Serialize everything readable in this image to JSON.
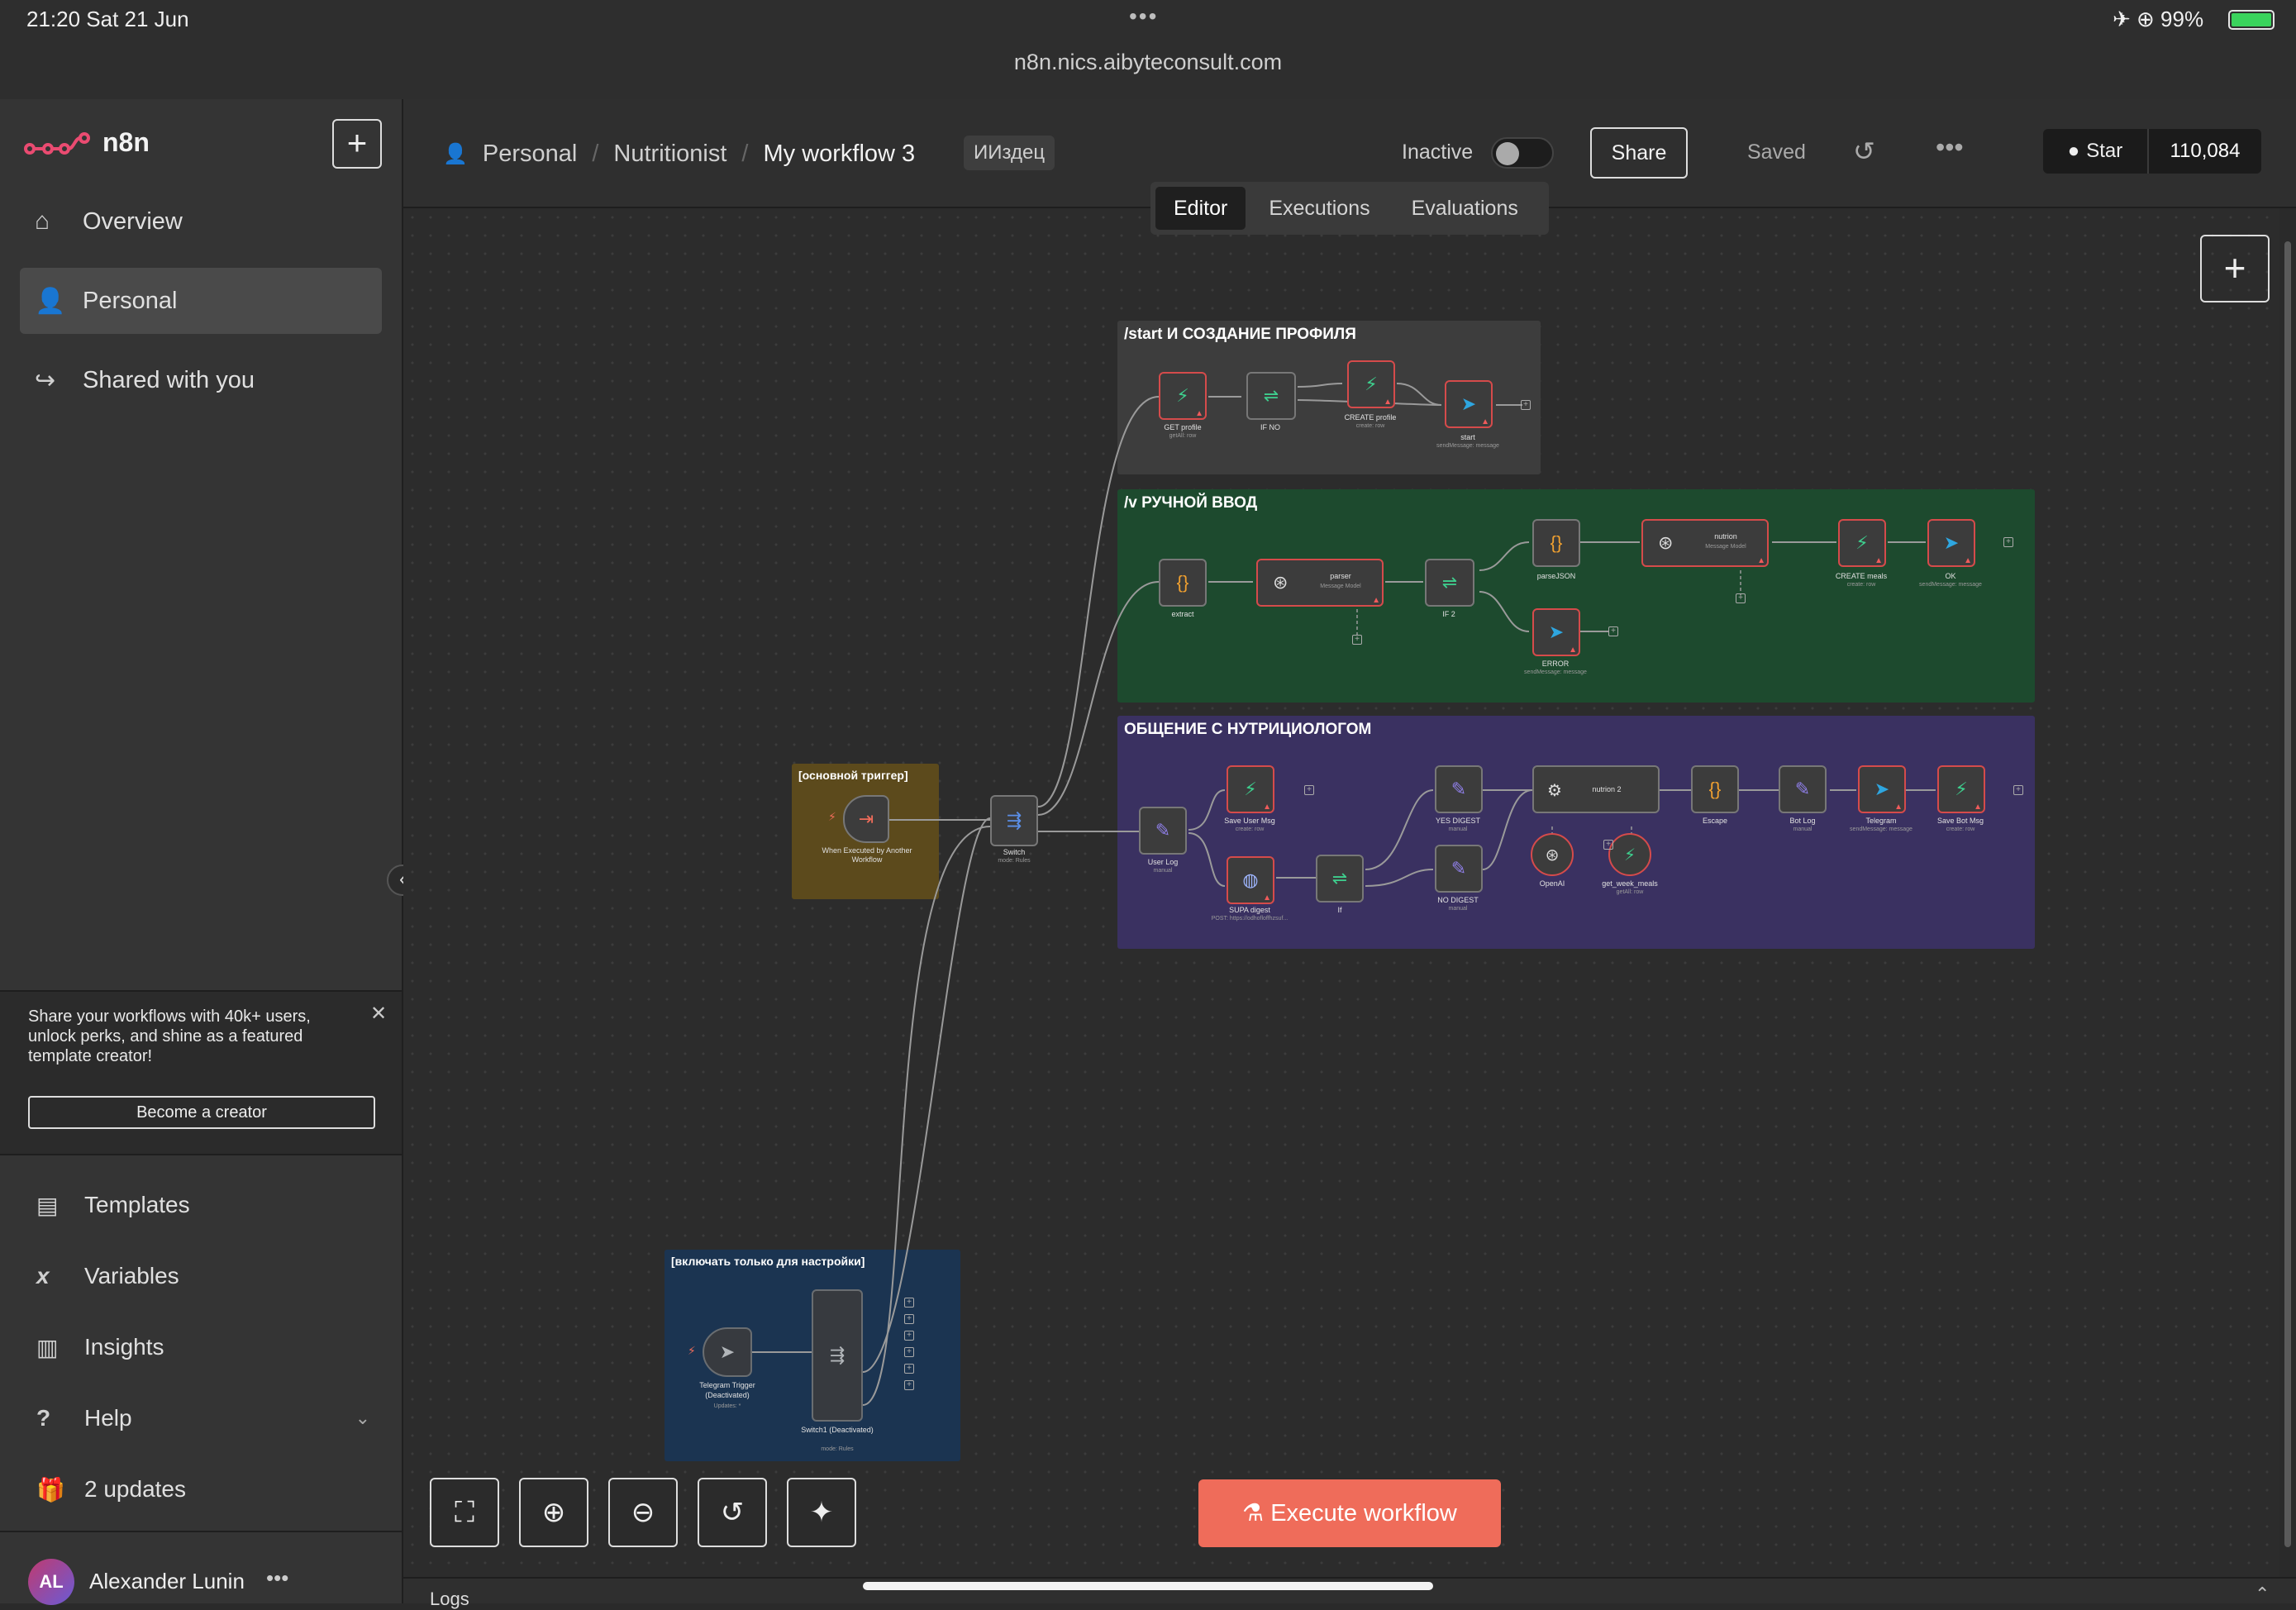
{
  "status_bar": {
    "time": "21:20  Sat 21 Jun",
    "dots": "•••",
    "url": "n8n.nics.aibyteconsult.com",
    "right": "✈ ⊕ 99%"
  },
  "sidebar": {
    "logo_text": "n8n",
    "new_icon": "plus-icon",
    "items": [
      {
        "label": "Overview",
        "icon": "home-icon"
      },
      {
        "label": "Personal",
        "icon": "user-icon"
      },
      {
        "label": "Shared with you",
        "icon": "share-icon"
      }
    ],
    "promo": {
      "text": "Share your workflows with 40k+ users, unlock perks, and shine as a featured template creator!",
      "button": "Become a creator"
    },
    "bottom_items": [
      {
        "label": "Templates",
        "icon": "templates-icon"
      },
      {
        "label": "Variables",
        "icon": "variables-icon"
      },
      {
        "label": "Insights",
        "icon": "insights-icon"
      },
      {
        "label": "Help",
        "icon": "help-icon"
      },
      {
        "label": "2 updates",
        "icon": "gift-icon"
      }
    ],
    "user": {
      "initials": "AL",
      "name": "Alexander Lunin",
      "more": "•••"
    }
  },
  "header": {
    "breadcrumb": [
      "Personal",
      "Nutritionist",
      "My workflow 3"
    ],
    "tag": "ИИздец",
    "status_label": "Inactive",
    "share": "Share",
    "saved": "Saved",
    "more": "•••",
    "github": {
      "label": "Star",
      "count": "110,084"
    },
    "tabs": [
      "Editor",
      "Executions",
      "Evaluations"
    ]
  },
  "canvas": {
    "stickies": [
      {
        "id": "s1",
        "title": "/start И СОЗДАНИЕ ПРОФИЛЯ",
        "color": "#3d3d3d"
      },
      {
        "id": "s2",
        "title": "/v РУЧНОЙ ВВОД",
        "color": "#1d4a2e"
      },
      {
        "id": "s3",
        "title": "ОБЩЕНИЕ С НУТРИЦИОЛОГОМ",
        "color": "#3a3161"
      },
      {
        "id": "s4",
        "title": "[основной триггер]",
        "color": "#5c4a1c"
      },
      {
        "id": "s5",
        "title": "[включать только для настройки]",
        "color": "#1b3451"
      }
    ],
    "nodes": {
      "get_profile": {
        "label": "GET profile",
        "sub": "getAll: row"
      },
      "if_no": {
        "label": "IF NO",
        "sub": ""
      },
      "create_profile": {
        "label": "CREATE profile",
        "sub": "create: row"
      },
      "start": {
        "label": "start",
        "sub": "sendMessage: message"
      },
      "extract": {
        "label": "extract",
        "sub": ""
      },
      "parser": {
        "label": "parser",
        "sub": "Message Model"
      },
      "if2": {
        "label": "IF 2",
        "sub": ""
      },
      "parsejson": {
        "label": "parseJSON",
        "sub": ""
      },
      "nutrion": {
        "label": "nutrion",
        "sub": "Message Model"
      },
      "create_meals": {
        "label": "CREATE meals",
        "sub": "create: row"
      },
      "ok": {
        "label": "OK",
        "sub": "sendMessage: message"
      },
      "error": {
        "label": "ERROR",
        "sub": "sendMessage: message"
      },
      "trigger": {
        "label": "When Executed by Another Workflow",
        "sub": ""
      },
      "switch": {
        "label": "Switch",
        "sub": "mode: Rules"
      },
      "user_log": {
        "label": "User Log",
        "sub": "manual"
      },
      "save_user_msg": {
        "label": "Save User Msg",
        "sub": "create: row"
      },
      "supa_digest": {
        "label": "SUPA digest",
        "sub": "POST: https://odhofloffhzsuf..."
      },
      "if": {
        "label": "If",
        "sub": ""
      },
      "yes_digest": {
        "label": "YES DIGEST",
        "sub": "manual"
      },
      "no_digest": {
        "label": "NO DIGEST",
        "sub": "manual"
      },
      "nutrion2": {
        "label": "nutrion 2",
        "sub": ""
      },
      "openai": {
        "label": "OpenAI",
        "sub": ""
      },
      "get_week_meals": {
        "label": "get_week_meals",
        "sub": "getAll: row"
      },
      "escape": {
        "label": "Escape",
        "sub": ""
      },
      "bot_log": {
        "label": "Bot Log",
        "sub": "manual"
      },
      "telegram": {
        "label": "Telegram",
        "sub": "sendMessage: message"
      },
      "save_bot_msg": {
        "label": "Save Bot Msg",
        "sub": "create: row"
      },
      "tg_trigger": {
        "label": "Telegram Trigger (Deactivated)",
        "sub": "Updates: *"
      },
      "switch1": {
        "label": "Switch1 (Deactivated)",
        "sub": "mode: Rules"
      }
    }
  },
  "controls": {
    "buttons": [
      {
        "name": "fit-view-button",
        "icon": "fullscreen-icon"
      },
      {
        "name": "zoom-in-button",
        "icon": "zoom-in-icon"
      },
      {
        "name": "zoom-out-button",
        "icon": "zoom-out-icon"
      },
      {
        "name": "reset-zoom-button",
        "icon": "reset-icon"
      },
      {
        "name": "tidy-up-button",
        "icon": "broom-icon"
      }
    ],
    "execute": "Execute workflow"
  },
  "footer": {
    "logs": "Logs"
  },
  "colors": {
    "accent": "#ef6c5a",
    "supabase": "#3ecf8e",
    "telegram": "#2ea6e0",
    "code": "#f0a030",
    "switch": "#5b8fe8",
    "edit": "#8f7fe8",
    "error_border": "#d54b4b"
  }
}
